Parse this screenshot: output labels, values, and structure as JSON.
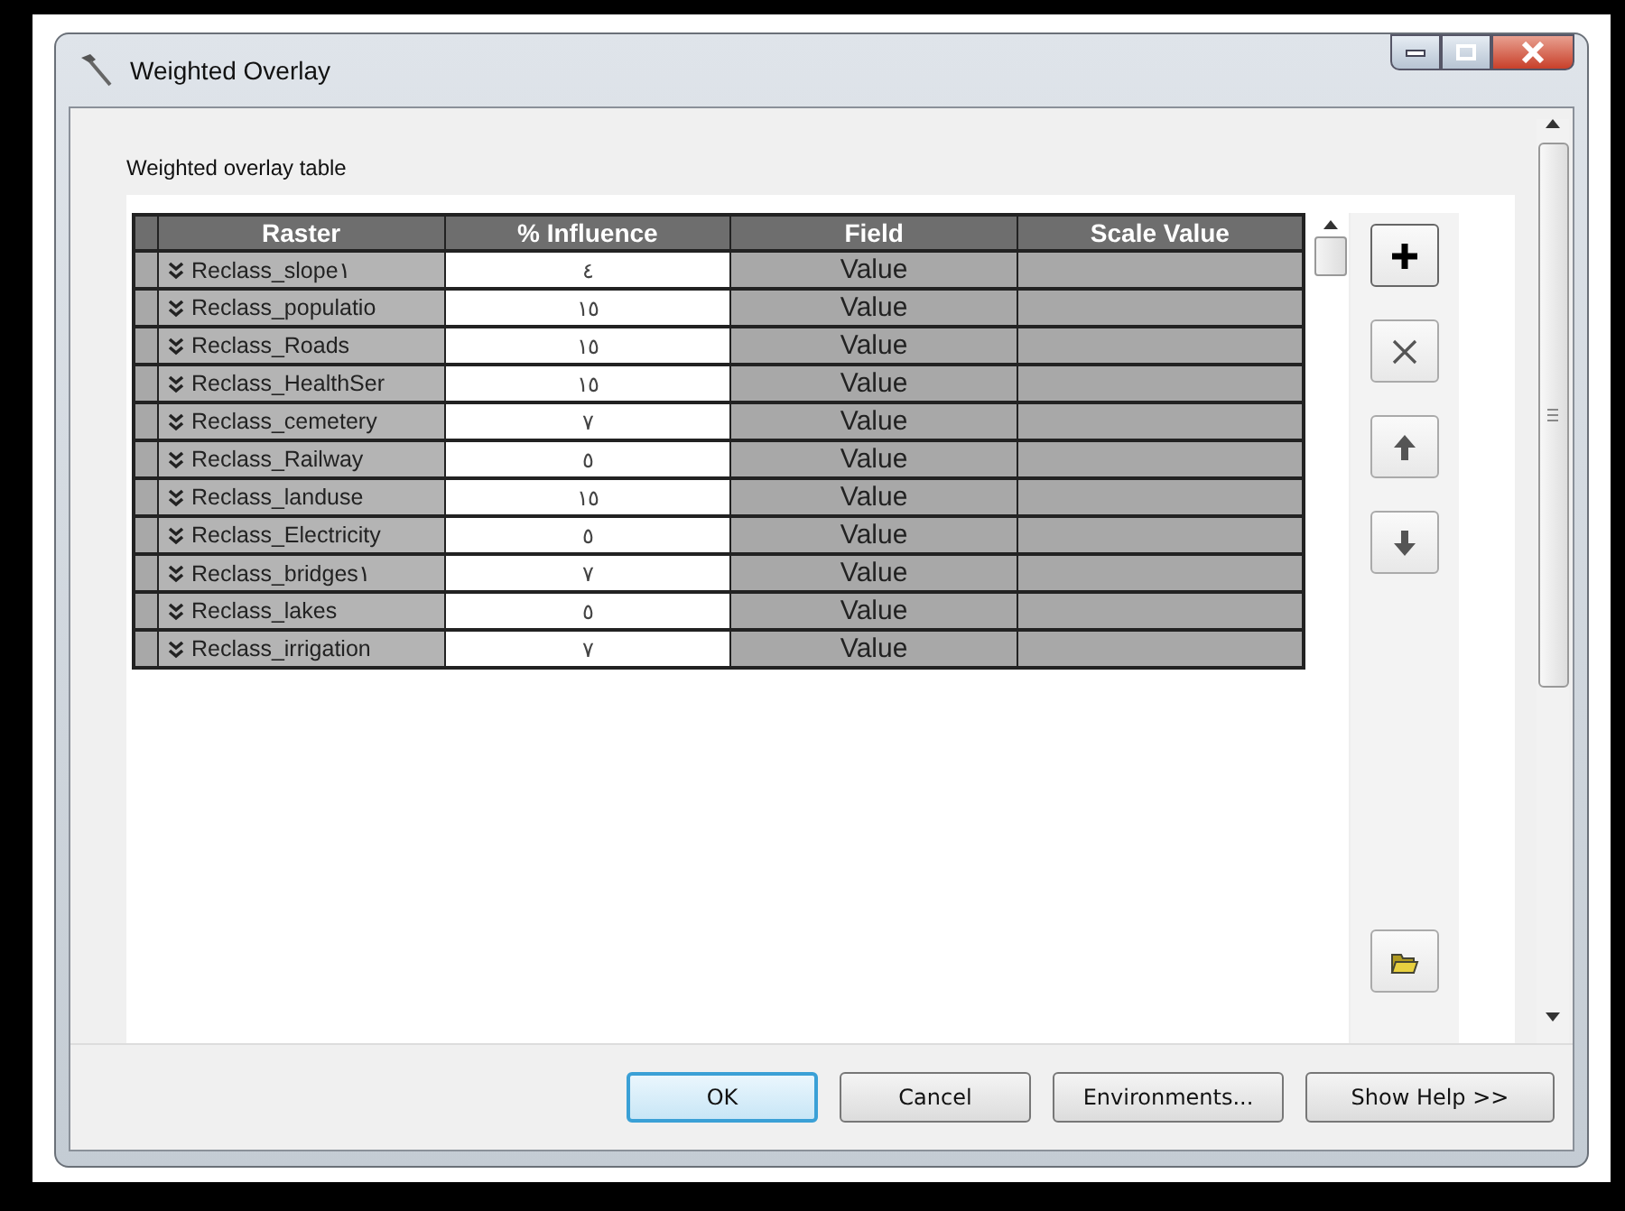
{
  "window": {
    "title": "Weighted Overlay"
  },
  "section_label": "Weighted overlay table",
  "table": {
    "columns": [
      "Raster",
      "% Influence",
      "Field",
      "Scale Value"
    ],
    "rows": [
      {
        "raster": "Reclass_slope١",
        "influence": "٤",
        "field": "Value"
      },
      {
        "raster": "Reclass_populatio",
        "influence": "١٥",
        "field": "Value"
      },
      {
        "raster": "Reclass_Roads",
        "influence": "١٥",
        "field": "Value"
      },
      {
        "raster": "Reclass_HealthSer",
        "influence": "١٥",
        "field": "Value"
      },
      {
        "raster": "Reclass_cemetery",
        "influence": "٧",
        "field": "Value"
      },
      {
        "raster": "Reclass_Railway",
        "influence": "٥",
        "field": "Value"
      },
      {
        "raster": "Reclass_landuse",
        "influence": "١٥",
        "field": "Value"
      },
      {
        "raster": "Reclass_Electricity",
        "influence": "٥",
        "field": "Value"
      },
      {
        "raster": "Reclass_bridges١",
        "influence": "٧",
        "field": "Value"
      },
      {
        "raster": "Reclass_lakes",
        "influence": "٥",
        "field": "Value"
      },
      {
        "raster": "Reclass_irrigation",
        "influence": "٧",
        "field": "Value"
      }
    ]
  },
  "tools": [
    {
      "kind": "add"
    },
    {
      "kind": "remove"
    },
    {
      "kind": "up"
    },
    {
      "kind": "down"
    },
    {
      "kind": "open"
    }
  ],
  "buttons": [
    {
      "label": "OK",
      "default": true
    },
    {
      "label": "Cancel",
      "default": false
    },
    {
      "label": "Environments...",
      "default": false
    },
    {
      "label": "Show Help >>",
      "default": false
    }
  ]
}
